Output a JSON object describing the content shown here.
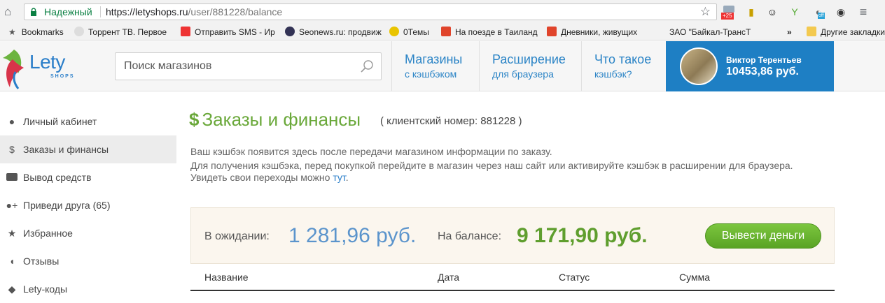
{
  "browser": {
    "secure_label": "Надежный",
    "url_host": "https://letyshops.ru",
    "url_path": "/user/881228/balance",
    "badge": "+25",
    "off_badge": "off"
  },
  "bookmarks": {
    "items": [
      "Bookmarks",
      "Торрент ТВ. Первое",
      "Отправить SMS - Ир",
      "Seonews.ru: продвиж",
      "0Темы",
      "На поезде в Таиланд",
      "Дневники, живущих",
      "ЗАО \"Байкал-ТрансТ"
    ],
    "more": "»",
    "other": "Другие закладки"
  },
  "header": {
    "logo": "Lety",
    "logo_sub": "SHOPS",
    "search_placeholder": "Поиск магазинов",
    "nav": [
      {
        "title": "Магазины",
        "sub": "с кэшбэком"
      },
      {
        "title": "Расширение",
        "sub": "для браузера"
      },
      {
        "title": "Что такое",
        "sub": "кэшбэк?"
      }
    ],
    "user_name": "Виктор Терентьев",
    "user_balance": "10453,86 руб."
  },
  "sidebar": {
    "items": [
      {
        "label": "Личный кабинет",
        "icon": "user-icon"
      },
      {
        "label": "Заказы и финансы",
        "icon": "dollar-icon"
      },
      {
        "label": "Вывод средств",
        "icon": "card-icon"
      },
      {
        "label": "Приведи друга (65)",
        "icon": "add-user-icon"
      },
      {
        "label": "Избранное",
        "icon": "star-icon"
      },
      {
        "label": "Отзывы",
        "icon": "comments-icon"
      },
      {
        "label": "Lety-коды",
        "icon": "tag-icon"
      }
    ]
  },
  "main": {
    "title_symbol": "$",
    "title": "Заказы и финансы",
    "client": "( клиентский номер: 881228 )",
    "info_line1": "Ваш кэшбэк появится здесь после передачи магазином информации по заказу.",
    "info_line2": "Для получения кэшбэка, перед покупкой перейдите в магазин через наш сайт или активируйте кэшбэк в расширении для браузера.",
    "info_line3_prefix": "Увидеть свои переходы можно ",
    "info_link": "тут",
    "info_line3_suffix": ".",
    "pending_label": "В ожидании:",
    "pending_value": "1 281,96 руб.",
    "balance_label": "На балансе:",
    "balance_value": "9 171,90 руб.",
    "withdraw_button": "Вывести деньги",
    "columns": [
      "Название",
      "Дата",
      "Статус",
      "Сумма"
    ]
  }
}
